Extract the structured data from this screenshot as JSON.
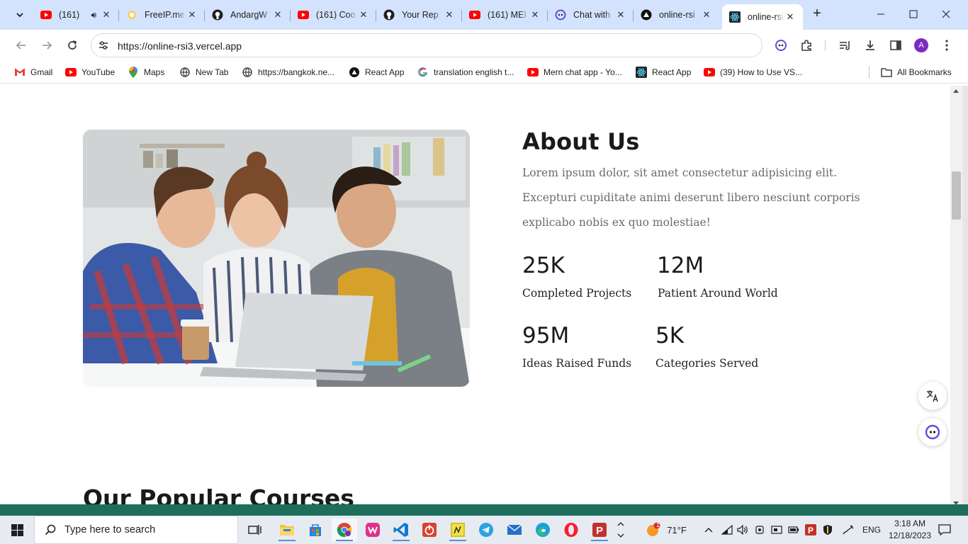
{
  "browser": {
    "tabs": [
      {
        "title": "(161)",
        "icon": "youtube-icon",
        "audio": true
      },
      {
        "title": "FreeIP.me",
        "icon": "freeip-icon"
      },
      {
        "title": "AndargW",
        "icon": "github-icon"
      },
      {
        "title": "(161) Coo",
        "icon": "youtube-icon"
      },
      {
        "title": "Your Rep",
        "icon": "github-icon"
      },
      {
        "title": "(161) MEI",
        "icon": "youtube-icon"
      },
      {
        "title": "Chat with",
        "icon": "copilot-icon"
      },
      {
        "title": "online-rsi",
        "icon": "vercel-icon"
      },
      {
        "title": "online-rsi",
        "icon": "react-icon",
        "active": true
      }
    ],
    "url": "https://online-rsi3.vercel.app",
    "profile_initial": "A",
    "bookmarks": [
      {
        "label": "Gmail",
        "icon": "gmail-icon"
      },
      {
        "label": "YouTube",
        "icon": "youtube-icon"
      },
      {
        "label": "Maps",
        "icon": "maps-icon"
      },
      {
        "label": "New Tab",
        "icon": "globe-icon"
      },
      {
        "label": "https://bangkok.ne...",
        "icon": "globe-icon"
      },
      {
        "label": "React App",
        "icon": "vercel-icon"
      },
      {
        "label": "translation english t...",
        "icon": "google-icon"
      },
      {
        "label": "Mern chat app - Yo...",
        "icon": "youtube-icon"
      },
      {
        "label": "React App",
        "icon": "react-icon"
      },
      {
        "label": "(39) How to Use VS...",
        "icon": "youtube-icon"
      }
    ],
    "all_bookmarks": "All Bookmarks"
  },
  "page": {
    "about": {
      "title": "About Us",
      "body": "Lorem ipsum dolor, sit amet consectetur adipisicing elit. Excepturi cupiditate animi deserunt libero nesciunt corporis explicabo nobis ex quo molestiae!",
      "stats": [
        {
          "value": "25K",
          "label": "Completed Projects"
        },
        {
          "value": "12M",
          "label": "Patient Around World"
        },
        {
          "value": "95M",
          "label": "Ideas Raised Funds"
        },
        {
          "value": "5K",
          "label": "Categories Served"
        }
      ]
    },
    "courses_title": "Our Popular Courses"
  },
  "taskbar": {
    "search_placeholder": "Type here to search",
    "weather": "71°F",
    "language": "ENG",
    "time": "3:18 AM",
    "date": "12/18/2023",
    "weather_badge": "1"
  },
  "colors": {
    "tabstrip": "#d3e3fd",
    "youtube": "#ff0000",
    "heading": "#1a1a1a",
    "body_text": "#6b6b6b",
    "profile": "#7b2cbf"
  }
}
